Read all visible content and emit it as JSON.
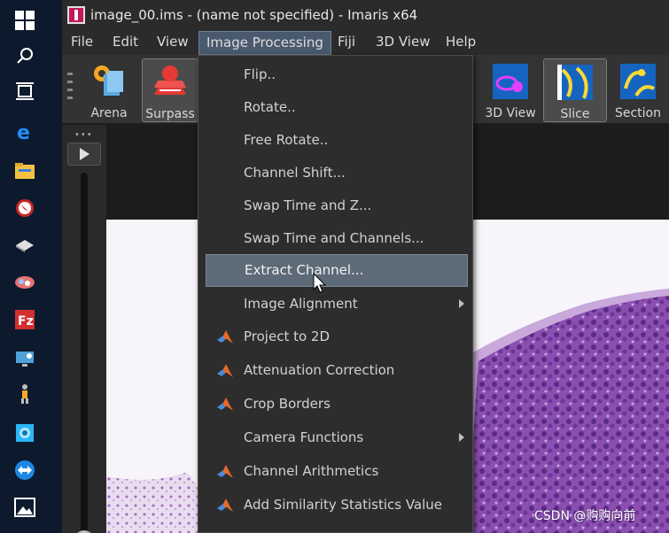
{
  "window": {
    "title": "image_00.ims - (name not specified) - Imaris x64"
  },
  "menubar": {
    "items": [
      "File",
      "Edit",
      "View",
      "Image Processing",
      "Fiji",
      "3D View",
      "Help"
    ],
    "active": "Image Processing"
  },
  "toolbar": {
    "arena": "Arena",
    "surpass": "Surpass",
    "view3d": "3D View",
    "slice": "Slice",
    "section": "Section"
  },
  "dropdown": {
    "items": [
      {
        "label": "Flip..",
        "icon": "none"
      },
      {
        "label": "Rotate..",
        "icon": "none"
      },
      {
        "label": "Free Rotate..",
        "icon": "none"
      },
      {
        "label": "Channel Shift...",
        "icon": "none"
      },
      {
        "label": "Swap Time and Z...",
        "icon": "none"
      },
      {
        "label": "Swap Time and Channels...",
        "icon": "none"
      },
      {
        "label": "Extract Channel...",
        "icon": "none",
        "highlighted": true
      },
      {
        "label": "Image Alignment",
        "icon": "none",
        "submenu": true
      },
      {
        "label": "Project to 2D",
        "icon": "matlab-icon"
      },
      {
        "label": "Attenuation Correction",
        "icon": "matlab-icon"
      },
      {
        "label": "Crop Borders",
        "icon": "matlab-icon"
      },
      {
        "label": "Camera Functions",
        "icon": "none",
        "submenu": true
      },
      {
        "label": "Channel Arithmetics",
        "icon": "matlab-icon"
      },
      {
        "label": "Add Similarity Statistics Value",
        "icon": "matlab-icon"
      }
    ]
  },
  "watermark": "CSDN @购购向前",
  "colors": {
    "highlight": "#5d6a78",
    "menu_bg": "#2d2d2d",
    "taskbar": "#0d1a2e",
    "tissue": "#8a4fb0"
  }
}
